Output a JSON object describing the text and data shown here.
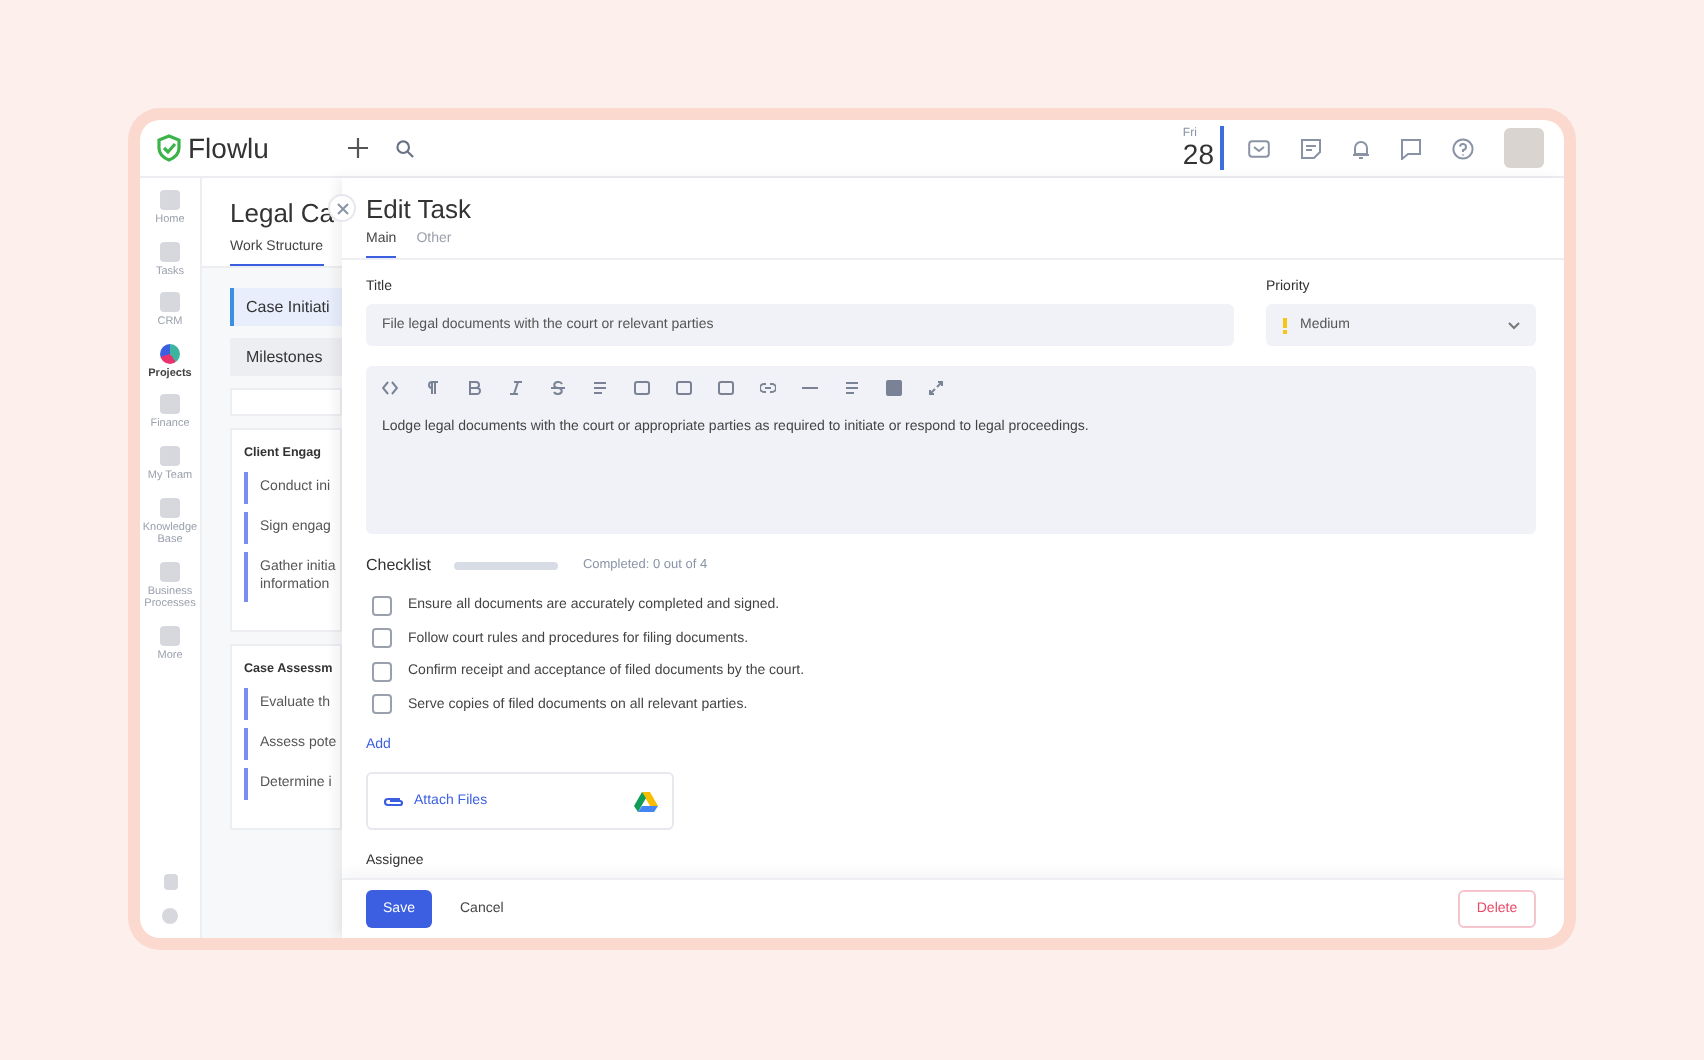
{
  "app": {
    "logo": "Flowlu"
  },
  "header": {
    "day": "Fri",
    "date": "28"
  },
  "sidebar": {
    "items": [
      {
        "label": "Home",
        "selected": false
      },
      {
        "label": "Tasks",
        "selected": false
      },
      {
        "label": "CRM",
        "selected": false
      },
      {
        "label": "Projects",
        "selected": true
      },
      {
        "label": "Finance",
        "selected": false
      },
      {
        "label": "My Team",
        "selected": false
      },
      {
        "label": "Knowledge Base",
        "selected": false
      },
      {
        "label": "Business Processes",
        "selected": false
      },
      {
        "label": "More",
        "selected": false
      }
    ]
  },
  "project": {
    "title": "Legal Ca",
    "tab": "Work Structure",
    "stage": "Case Initiati",
    "milestones": "Milestones",
    "groups": [
      {
        "title": "Client Engag",
        "tasks": [
          "Conduct ini",
          "Sign engag",
          "Gather initia\ninformation"
        ]
      },
      {
        "title": "Case Assessm",
        "tasks": [
          "Evaluate th",
          "Assess pote",
          "Determine i"
        ]
      }
    ]
  },
  "modal": {
    "title": "Edit Task",
    "tabs": [
      {
        "label": "Main",
        "selected": true
      },
      {
        "label": "Other",
        "selected": false
      }
    ],
    "title_label": "Title",
    "title_value": "File legal documents with the court or relevant parties",
    "priority_label": "Priority",
    "priority_value": "Medium",
    "description": "Lodge legal documents with the court or appropriate parties as required to initiate or respond to legal proceedings.",
    "checklist": {
      "label": "Checklist",
      "level": 0,
      "progress_text": "Completed: 0 out of 4",
      "items": [
        {
          "text": "Ensure all documents are accurately completed and signed.",
          "checked": false
        },
        {
          "text": "Follow court rules and procedures for filing documents.",
          "checked": false
        },
        {
          "text": "Confirm receipt and acceptance of filed documents by the court.",
          "checked": false
        },
        {
          "text": "Serve copies of filed documents on all relevant parties.",
          "checked": false
        }
      ],
      "add": "Add"
    },
    "attach": "Attach Files",
    "assignee_label": "Assignee",
    "buttons": {
      "save": "Save",
      "cancel": "Cancel",
      "delete": "Delete"
    }
  }
}
